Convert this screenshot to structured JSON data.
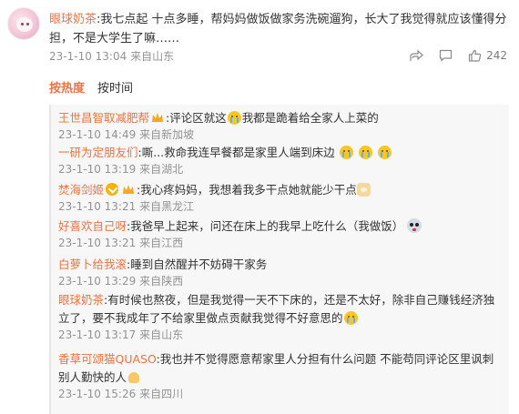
{
  "post": {
    "author": "眼球奶茶",
    "text": ":我七点起 十点多睡，帮妈妈做饭做家务洗碗遛狗，长大了我觉得就应该懂得分担，不是大学生了嘛……",
    "time": "23-1-10 13:04",
    "location": "来自山东",
    "like_count": "242"
  },
  "sort": {
    "hot": "按热度",
    "time": "按时间"
  },
  "replies": [
    {
      "author": "王世昌智取减肥帮",
      "text": ":评论区就这",
      "text2": "我都是跪着给全家人上菜的",
      "time": "23-1-10 14:49",
      "location": "来自新加坡"
    },
    {
      "author": "一研为定朋友们",
      "text": ":嘶...救命我连早餐都是家里人端到床边",
      "time": "23-1-10 13:19",
      "location": "来自湖北"
    },
    {
      "author": "焚海剑姬",
      "text": ":我心疼妈妈，我想着我多干点她就能少干点",
      "time": "23-1-10 13:21",
      "location": "来自黑龙江"
    },
    {
      "author": "好喜欢自己呀",
      "text": ":我爸早上起来，问还在床上的我早上吃什么（我做饭）",
      "time": "23-1-10 13:21",
      "location": "来自江西"
    },
    {
      "author": "白萝卜给我滚",
      "text": ":睡到自然醒并不妨碍干家务",
      "time": "23-1-10 13:29",
      "location": "来自陕西"
    },
    {
      "author": "眼球奶茶",
      "text": ":有时候也熬夜，但是我觉得一天不下床的，还是不太好，除非自己赚钱经济独立了，要不我成年了不给家里做点贡献我觉得不好意思的",
      "time": "23-1-10 13:17",
      "location": "来自山东"
    },
    {
      "author": "香草可颂猫QUASO",
      "text": ":我也并不觉得愿意帮家里人分担有什么问题 不能苟同评论区里讽刺别人勤快的人",
      "time": "23-1-10 15:26",
      "location": "来自四川"
    }
  ]
}
